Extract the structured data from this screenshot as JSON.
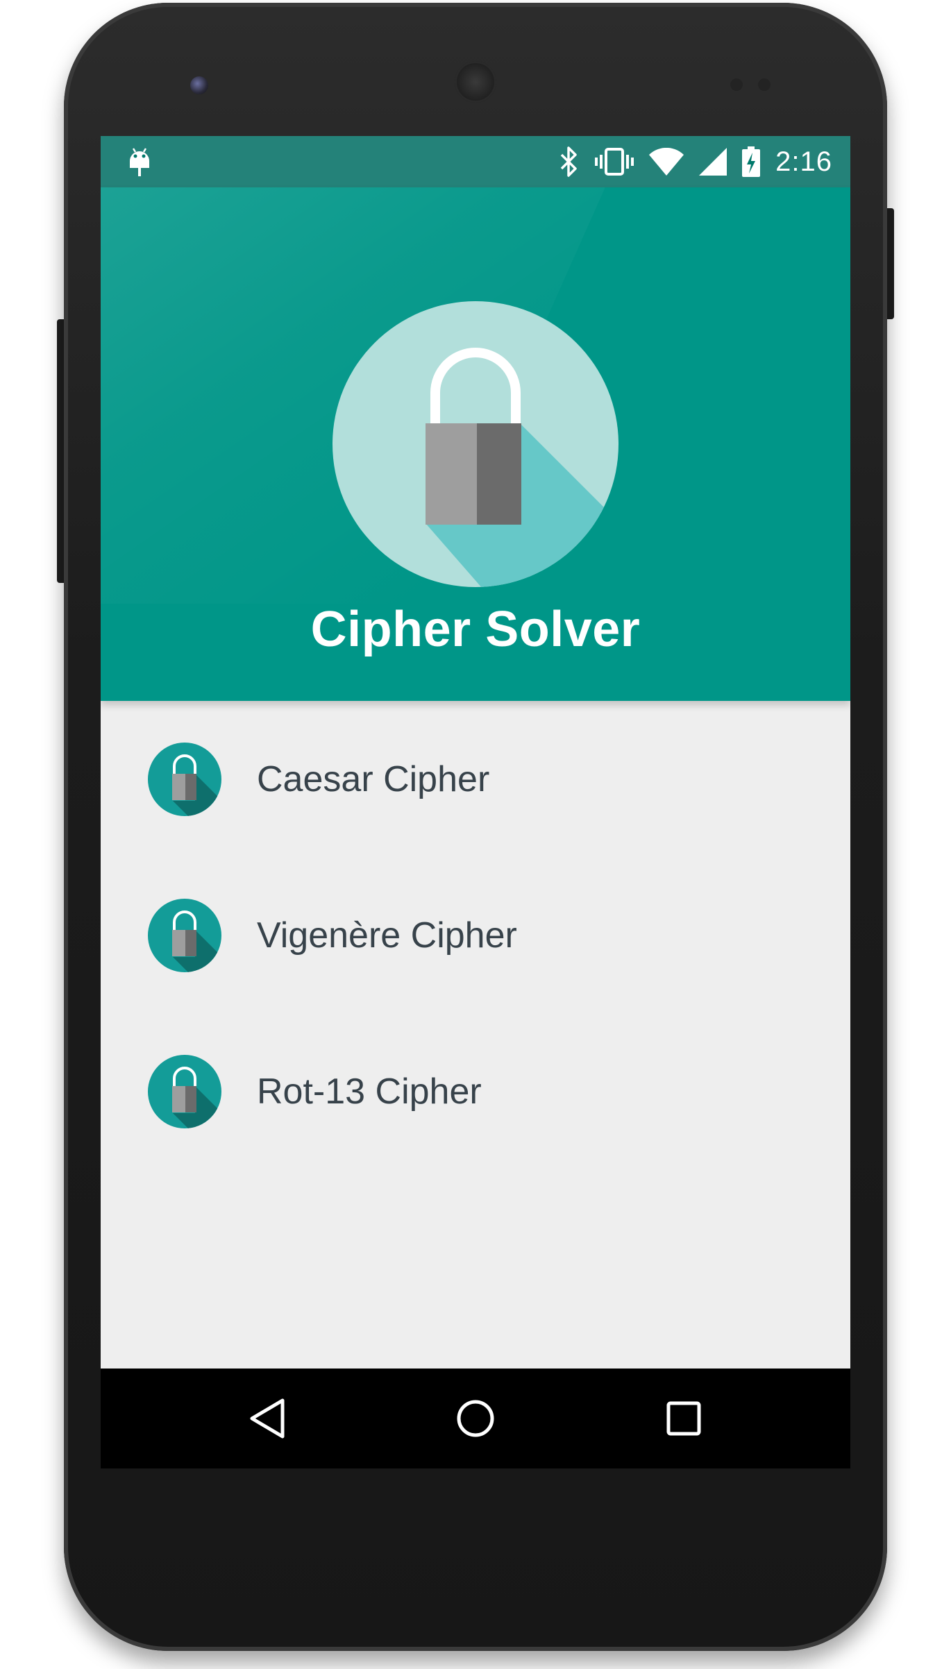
{
  "status_bar": {
    "time": "2:16",
    "icons": [
      "android-debug-icon",
      "bluetooth-icon",
      "vibrate-icon",
      "wifi-icon",
      "cell-signal-icon",
      "battery-charging-icon"
    ]
  },
  "header": {
    "title": "Cipher Solver",
    "logo_icon": "padlock-icon"
  },
  "list": {
    "items": [
      {
        "label": "Caesar Cipher",
        "icon": "padlock-icon"
      },
      {
        "label": "Vigenère Cipher",
        "icon": "padlock-icon"
      },
      {
        "label": "Rot-13 Cipher",
        "icon": "padlock-icon"
      }
    ]
  },
  "nav_bar": {
    "buttons": [
      "back-icon",
      "home-icon",
      "recents-icon"
    ]
  },
  "colors": {
    "primary": "#009688",
    "primary_dark": "#00796b",
    "list_background": "#eeeeee",
    "list_text": "#37424a",
    "logo_circle": "#b2dfdb",
    "logo_shadow": "#66c8c8",
    "item_icon_circle": "#139c98",
    "lock_light": "#9e9e9e",
    "lock_dark": "#6b6b6b"
  }
}
